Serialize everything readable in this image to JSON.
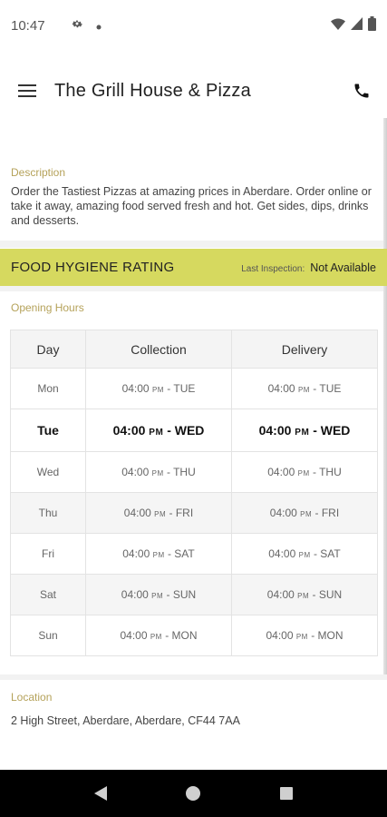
{
  "status_bar": {
    "time": "10:47"
  },
  "app_bar": {
    "title": "The Grill House & Pizza"
  },
  "description": {
    "label": "Description",
    "text": "Order the Tastiest Pizzas at amazing prices in Aberdare. Order online or take it away, amazing food served fresh and hot. Get sides, dips, drinks and desserts."
  },
  "hygiene": {
    "title": "FOOD HYGIENE RATING",
    "inspection_label": "Last Inspection:",
    "inspection_value": "Not Available",
    "color": "#d6d95f"
  },
  "opening_hours": {
    "label": "Opening Hours",
    "headers": [
      "Day",
      "Collection",
      "Delivery"
    ],
    "rows": [
      {
        "day": "Mon",
        "collection_time": "04:00",
        "collection_pm": "PM",
        "collection_end": "- TUE",
        "delivery_time": "04:00",
        "delivery_pm": "PM",
        "delivery_end": "- TUE"
      },
      {
        "day": "Tue",
        "collection_time": "04:00",
        "collection_pm": "PM",
        "collection_end": "- WED",
        "delivery_time": "04:00",
        "delivery_pm": "PM",
        "delivery_end": "- WED"
      },
      {
        "day": "Wed",
        "collection_time": "04:00",
        "collection_pm": "PM",
        "collection_end": "- THU",
        "delivery_time": "04:00",
        "delivery_pm": "PM",
        "delivery_end": "- THU"
      },
      {
        "day": "Thu",
        "collection_time": "04:00",
        "collection_pm": "PM",
        "collection_end": "- FRI",
        "delivery_time": "04:00",
        "delivery_pm": "PM",
        "delivery_end": "- FRI"
      },
      {
        "day": "Fri",
        "collection_time": "04:00",
        "collection_pm": "PM",
        "collection_end": "- SAT",
        "delivery_time": "04:00",
        "delivery_pm": "PM",
        "delivery_end": "- SAT"
      },
      {
        "day": "Sat",
        "collection_time": "04:00",
        "collection_pm": "PM",
        "collection_end": "- SUN",
        "delivery_time": "04:00",
        "delivery_pm": "PM",
        "delivery_end": "- SUN"
      },
      {
        "day": "Sun",
        "collection_time": "04:00",
        "collection_pm": "PM",
        "collection_end": "- MON",
        "delivery_time": "04:00",
        "delivery_pm": "PM",
        "delivery_end": "- MON"
      }
    ]
  },
  "location": {
    "label": "Location",
    "address": "2 High Street, Aberdare, Aberdare, CF44 7AA"
  },
  "colors": {
    "label_gold": "#b5a25a",
    "hygiene_bg": "#d6d95f"
  },
  "icons": [
    "settings-icon",
    "wifi-icon",
    "signal-icon",
    "battery-icon",
    "menu-icon",
    "phone-icon",
    "back-icon",
    "home-icon",
    "recents-icon"
  ]
}
